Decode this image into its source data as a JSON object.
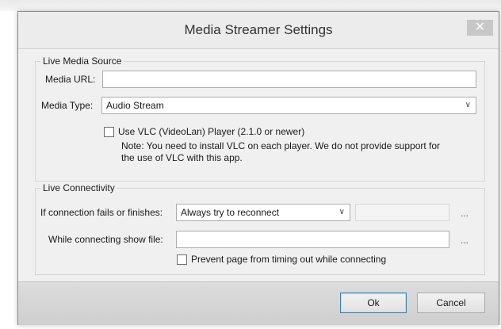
{
  "dialog": {
    "title": "Media Streamer Settings",
    "close_glyph": "✕"
  },
  "live_media_source": {
    "legend": "Live Media Source",
    "media_url_label": "Media URL:",
    "media_url_value": "",
    "media_type_label": "Media Type:",
    "media_type_value": "Audio Stream",
    "vlc_checkbox_label": "Use VLC (VideoLan) Player (2.1.0 or newer)",
    "vlc_checked": false,
    "note_line1": "Note: You need to install VLC on each player.  We do not provide support for",
    "note_line2": "the use of VLC with this app."
  },
  "live_connectivity": {
    "legend": "Live Connectivity",
    "fail_label": "If connection fails or finishes:",
    "fail_value": "Always try to reconnect",
    "fail_browse": "...",
    "show_file_label": "While connecting show file:",
    "show_file_value": "",
    "show_file_browse": "...",
    "prevent_timeout_label": "Prevent page from timing out while connecting",
    "prevent_timeout_checked": false
  },
  "buttons": {
    "ok": "Ok",
    "cancel": "Cancel"
  }
}
